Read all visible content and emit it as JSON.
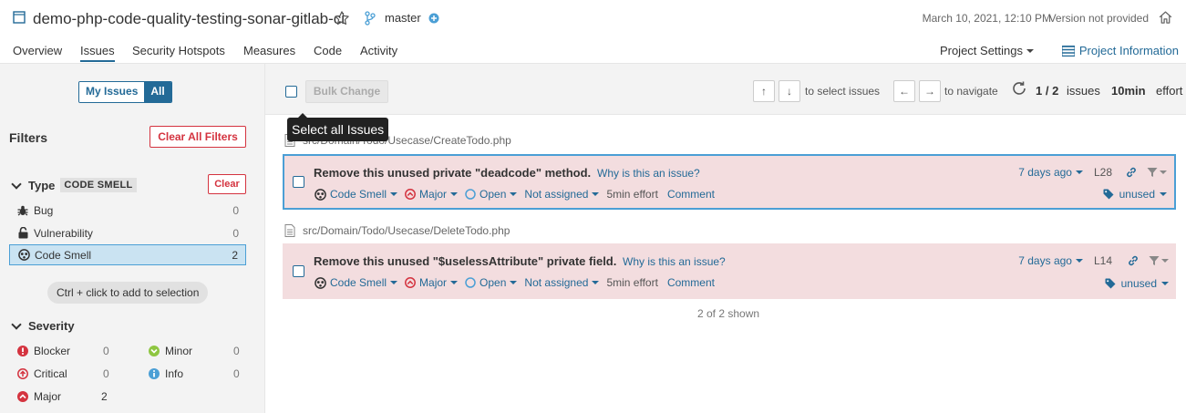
{
  "header": {
    "project_title": "demo-php-code-quality-testing-sonar-gitlab-ci",
    "branch": "master",
    "analysis_date": "March 10, 2021, 12:10 PM",
    "version": "Version not provided",
    "icons": [
      "project-icon",
      "star-icon",
      "branch-icon",
      "plus-circle-icon",
      "home-icon"
    ]
  },
  "nav": {
    "tabs": [
      "Overview",
      "Issues",
      "Security Hotspots",
      "Measures",
      "Code",
      "Activity"
    ],
    "active_tab": "Issues",
    "project_settings": "Project Settings",
    "project_information": "Project Information"
  },
  "sidebar": {
    "my_issues": "My Issues",
    "all": "All",
    "filters_title": "Filters",
    "clear_all": "Clear All Filters",
    "type": {
      "label": "Type",
      "chip": "CODE SMELL",
      "clear": "Clear",
      "items": [
        {
          "label": "Bug",
          "count": "0",
          "icon": "bug-icon"
        },
        {
          "label": "Vulnerability",
          "count": "0",
          "icon": "lock-icon"
        },
        {
          "label": "Code Smell",
          "count": "2",
          "icon": "code-smell-icon",
          "selected": true
        }
      ]
    },
    "hint": "Ctrl + click to add to selection",
    "severity": {
      "label": "Severity",
      "items": [
        {
          "label": "Blocker",
          "count": "0",
          "icon": "blocker-icon"
        },
        {
          "label": "Minor",
          "count": "0",
          "icon": "minor-icon"
        },
        {
          "label": "Critical",
          "count": "0",
          "icon": "critical-icon"
        },
        {
          "label": "Info",
          "count": "0",
          "icon": "info-icon"
        },
        {
          "label": "Major",
          "count": "2",
          "icon": "major-icon"
        }
      ]
    }
  },
  "toolbar": {
    "bulk_change": "Bulk Change",
    "up_key": "↑",
    "down_key": "↓",
    "select_text": "to select issues",
    "left_key": "←",
    "right_key": "→",
    "navigate_text": "to navigate",
    "count": "1 / 2",
    "issues_word": "issues",
    "effort_value": "10min",
    "effort_word": "effort"
  },
  "tooltip": "Select all Issues",
  "issues": [
    {
      "file": "src/Domain/Todo/Usecase/CreateTodo.php",
      "message": "Remove this unused private \"deadcode\" method.",
      "why": "Why is this an issue?",
      "type": "Code Smell",
      "severity": "Major",
      "status": "Open",
      "assignee": "Not assigned",
      "effort": "5min effort",
      "comment": "Comment",
      "age": "7 days ago",
      "line": "L28",
      "tag": "unused"
    },
    {
      "file": "src/Domain/Todo/Usecase/DeleteTodo.php",
      "message": "Remove this unused \"$uselessAttribute\" private field.",
      "why": "Why is this an issue?",
      "type": "Code Smell",
      "severity": "Major",
      "status": "Open",
      "assignee": "Not assigned",
      "effort": "5min effort",
      "comment": "Comment",
      "age": "7 days ago",
      "line": "L14",
      "tag": "unused"
    }
  ],
  "shown": "2 of 2 shown",
  "colors": {
    "accent": "#236a97",
    "danger": "#d4333f",
    "issue_bg": "#f3dddf",
    "selected_bg": "#cae3f2"
  }
}
